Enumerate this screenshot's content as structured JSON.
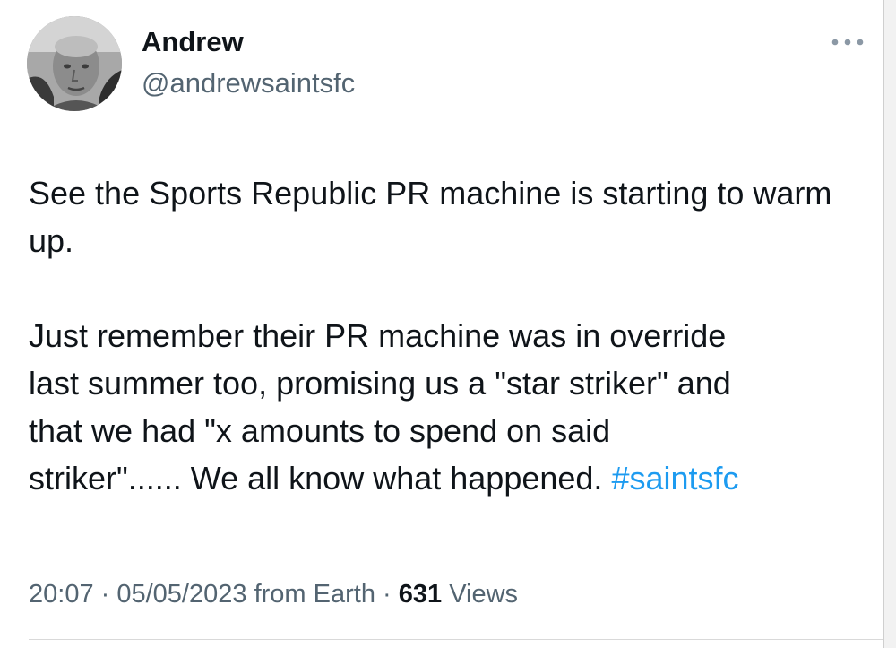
{
  "author": {
    "display_name": "Andrew",
    "handle": "@andrewsaintsfc",
    "avatar_icon": "profile-photo"
  },
  "more_icon": "more-horizontal-icon",
  "tweet": {
    "paragraph1": "See the Sports Republic PR machine is starting to warm up.",
    "paragraph2_lines": [
      "Just remember their PR machine was in override",
      "last summer too, promising us a \"star striker\" and",
      "that we had \"x amounts to spend on said",
      "striker\"...... We all know what happened. "
    ],
    "hashtag": "#saintsfc"
  },
  "meta": {
    "time": "20:07",
    "sep1": " · ",
    "date": "05/05/2023",
    "source_prefix": " from ",
    "source": "Earth",
    "sep2": " · ",
    "views_count": "631",
    "views_label": " Views"
  },
  "colors": {
    "text": "#0f1419",
    "secondary": "#536471",
    "link": "#1d9bf0"
  }
}
